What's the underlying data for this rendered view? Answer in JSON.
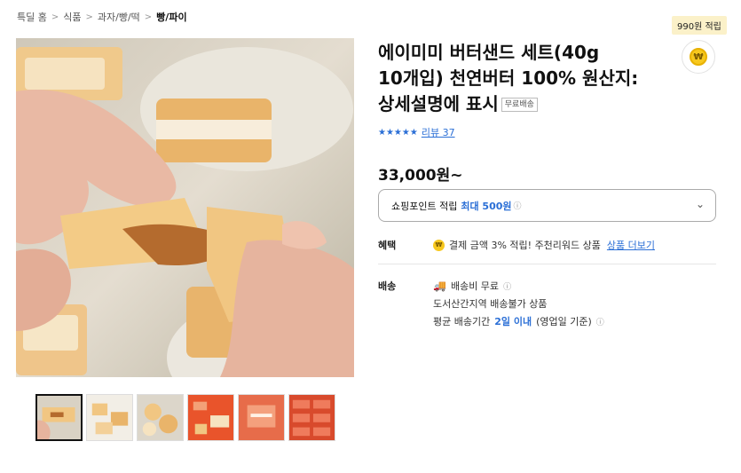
{
  "breadcrumb": {
    "items": [
      "특딜 홈",
      "식품",
      "과자/빵/떡"
    ],
    "current": "빵/파이",
    "separator": ">"
  },
  "points_badge": "990원 적립",
  "won_icon": "₩",
  "product": {
    "title": "에이미미 버터샌드 세트(40g 10개입) 천연버터 100% 원산지: 상세설명에 표시",
    "free_shipping_tag": "무료배송",
    "stars": "★★★★★",
    "review_link": "리뷰 37",
    "rating_stars": 5,
    "price": "33,000원~"
  },
  "point_select": {
    "label": "쇼핑포인트 적립",
    "max_label": "최대 500원",
    "info_icon": "ⓘ",
    "chevron": "⌄"
  },
  "benefit": {
    "label": "혜택",
    "icon": "₩",
    "text": "결제 금액 3% 적립! 주천리워드 상품",
    "link": "상품 더보기"
  },
  "shipping": {
    "label": "배송",
    "fee": "배송비 무료",
    "info_icon": "ⓘ",
    "island": "도서산간지역 배송불가 상품",
    "eta_prefix": "평균 배송기간",
    "eta_value": "2일 이내",
    "eta_suffix": "(영업일 기준)"
  },
  "colors": {
    "accent_blue": "#2b6fd6",
    "coin_yellow": "#f7c81e",
    "badge_bg": "#fbf1c9"
  },
  "thumbnails": [
    {
      "name": "thumb-1",
      "active": true
    },
    {
      "name": "thumb-2",
      "active": false
    },
    {
      "name": "thumb-3",
      "active": false
    },
    {
      "name": "thumb-4",
      "active": false
    },
    {
      "name": "thumb-5",
      "active": false
    },
    {
      "name": "thumb-6",
      "active": false
    }
  ]
}
